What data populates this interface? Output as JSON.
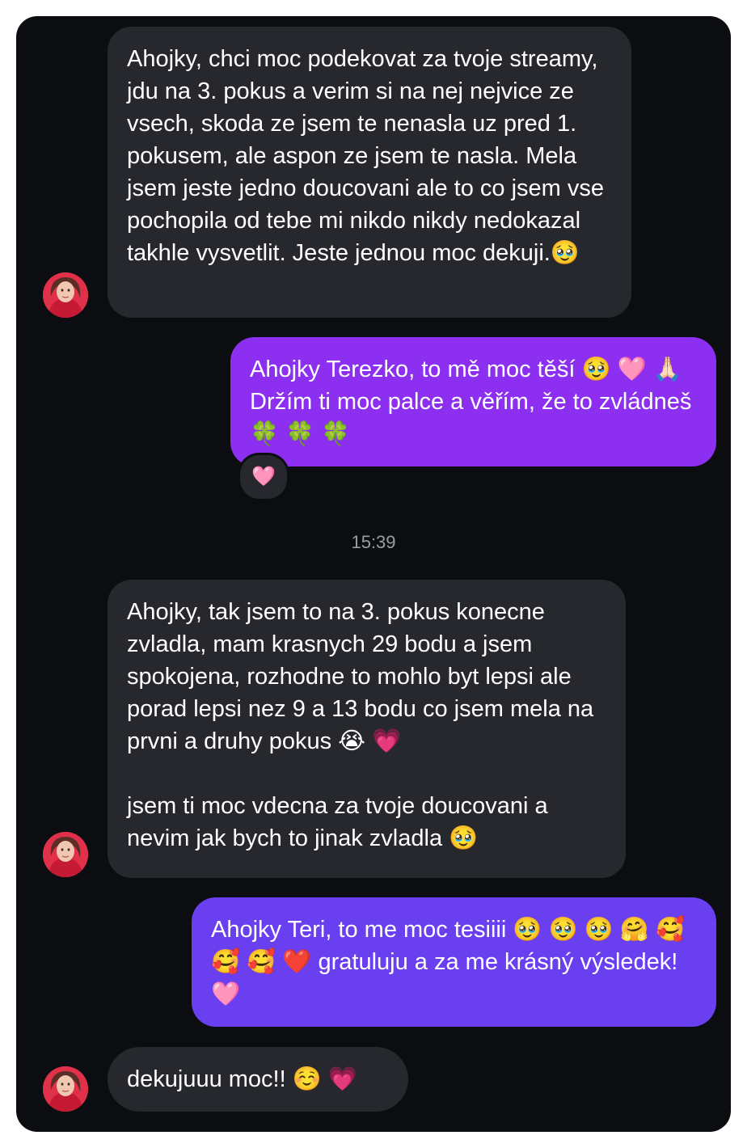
{
  "conversation": {
    "messages": [
      {
        "sender": "contact",
        "text": "Ahojky, chci moc podekovat za tvoje streamy, jdu na 3. pokus a verim si na nej nejvice ze vsech, skoda ze jsem te nenasla uz pred 1. pokusem, ale aspon ze jsem te nasla. Mela jsem jeste jedno doucovani ale to co jsem vse pochopila od tebe mi nikdo nikdy nedokazal takhle vysvetlit. Jeste jednou moc dekuji.🥹"
      },
      {
        "sender": "me",
        "text": "Ahojky Terezko, to mě moc těší 🥹 🩷 🙏🏻 Držím ti moc palce a věřím, že to zvládneš 🍀 🍀 🍀",
        "reaction": "🩷"
      },
      {
        "sender": "contact",
        "text": "Ahojky, tak jsem to na 3. pokus konecne zvladla, mam krasnych 29 bodu a jsem spokojena, rozhodne to mohlo byt lepsi ale porad lepsi nez 9 a 13 bodu co jsem mela na prvni a druhy pokus 😭 💗\n\njsem ti moc vdecna za tvoje doucovani a nevim jak bych to jinak zvladla 🥹"
      },
      {
        "sender": "me",
        "text": "Ahojky Teri, to me moc tesiiii 🥹 🥹 🥹 🤗 🥰 🥰 🥰 ❤️ gratuluju a za me krásný výsledek! 🩷"
      },
      {
        "sender": "contact",
        "text": "dekujuuu moc!! ☺️ 💗"
      }
    ],
    "timestamp": "15:39"
  },
  "colors": {
    "background": "#0b0d11",
    "incoming_bubble": "#26282d",
    "outgoing_bubble_1": "#8c2ff0",
    "outgoing_bubble_2": "#6a3ff0",
    "timestamp_text": "#9a9ca3"
  }
}
